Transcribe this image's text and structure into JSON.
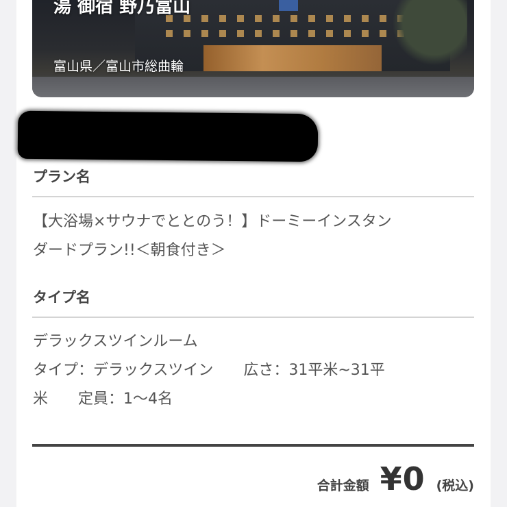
{
  "hotel": {
    "name": "湯 御宿 野乃富山",
    "location": "富山県／富山市総曲輪"
  },
  "plan": {
    "heading": "プラン名",
    "line1": "【大浴場×サウナでととのう！】ドーミーインスタン",
    "line2": "ダードプラン!!＜朝食付き＞"
  },
  "room": {
    "heading": "タイプ名",
    "line1": "デラックスツインルーム",
    "line2": "タイプ：デラックスツイン　　広さ：31平米~31平",
    "line3": "米　　定員：1～4名"
  },
  "total": {
    "label": "合計金額",
    "amount": "¥0",
    "tax": "(税込)"
  }
}
